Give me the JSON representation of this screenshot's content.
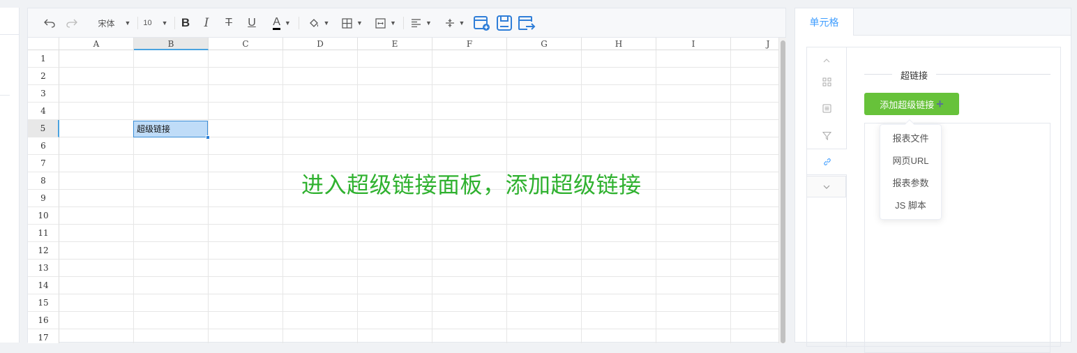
{
  "toolbar": {
    "font_family": "宋体",
    "font_size": "10",
    "text_color_label": "A",
    "colors": {
      "text_color_bar": "#000000",
      "accent_icons": "#2f7ed8"
    }
  },
  "sheet": {
    "columns": [
      "A",
      "B",
      "C",
      "D",
      "E",
      "F",
      "G",
      "H",
      "I",
      "J"
    ],
    "rows": [
      "1",
      "2",
      "3",
      "4",
      "5",
      "6",
      "7",
      "8",
      "9",
      "10",
      "11",
      "12",
      "13",
      "14",
      "15",
      "16",
      "17"
    ],
    "selected_column": "B",
    "selected_row": "5",
    "selected_cell_value": "超级链接"
  },
  "annotation": "进入超级链接面板，添加超级链接",
  "right_panel": {
    "tab_label": "单元格",
    "section_title": "超链接",
    "add_button_label": "添加超级链接",
    "add_button_plus": "+",
    "dropdown_items": [
      "报表文件",
      "网页URL",
      "报表参数",
      "JS 脚本"
    ],
    "colors": {
      "tab_active": "#409eff",
      "button": "#67c23a"
    }
  }
}
